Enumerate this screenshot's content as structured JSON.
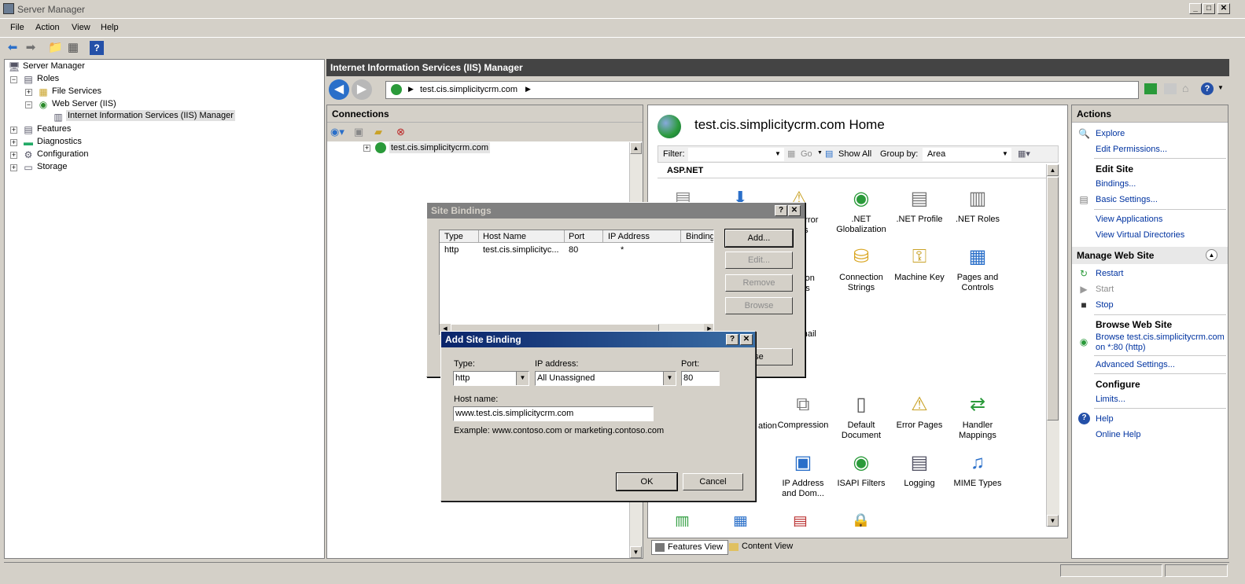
{
  "window": {
    "title": "Server Manager",
    "minimize": "_",
    "maximize": "□",
    "close": "✕"
  },
  "menu": [
    "File",
    "Action",
    "View",
    "Help"
  ],
  "tree": {
    "root": "Server Manager",
    "roles": "Roles",
    "file_services": "File Services",
    "web_server": "Web Server (IIS)",
    "iis_manager": "Internet Information Services (IIS) Manager",
    "features": "Features",
    "diagnostics": "Diagnostics",
    "configuration": "Configuration",
    "storage": "Storage"
  },
  "iis": {
    "header": "Internet Information Services (IIS) Manager",
    "address": "test.cis.simplicitycrm.com"
  },
  "connections": {
    "title": "Connections",
    "site": "test.cis.simplicitycrm.com"
  },
  "home": {
    "title": "test.cis.simplicitycrm.com Home",
    "filter_label": "Filter:",
    "go_label": "Go",
    "show_all": "Show All",
    "group_by_label": "Group by:",
    "group_by_value": "Area",
    "section": "ASP.NET",
    "features": [
      {
        "label": ".NET\nGlobalization"
      },
      {
        "label": ".NET Profile"
      },
      {
        "label": ".NET Roles"
      },
      {
        "label": "Connection\nStrings"
      },
      {
        "label": "Machine Key"
      },
      {
        "label": "Pages and\nControls"
      },
      {
        "label": "Compression"
      },
      {
        "label": "Default\nDocument"
      },
      {
        "label": "Error Pages"
      },
      {
        "label": "Handler\nMappings"
      },
      {
        "label": "IP Address\nand Dom..."
      },
      {
        "label": "ISAPI Filters"
      },
      {
        "label": "Logging"
      },
      {
        "label": "MIME Types"
      }
    ],
    "partial_error": "Error\nes",
    "partial_ation": "ation\nngs",
    "partial_mail": "-mail",
    "partial_ation2": "ation",
    "features_view": "Features View",
    "content_view": "Content View"
  },
  "actions": {
    "title": "Actions",
    "explore": "Explore",
    "edit_permissions": "Edit Permissions...",
    "edit_site": "Edit Site",
    "bindings": "Bindings...",
    "basic_settings": "Basic Settings...",
    "view_applications": "View Applications",
    "view_virtual_directories": "View Virtual Directories",
    "manage_web_site": "Manage Web Site",
    "restart": "Restart",
    "start": "Start",
    "stop": "Stop",
    "browse_web_site": "Browse Web Site",
    "browse_link_1": "Browse test.cis.simplicitycrm.com",
    "browse_link_2": "on *:80 (http)",
    "advanced_settings": "Advanced Settings...",
    "configure": "Configure",
    "limits": "Limits...",
    "help": "Help",
    "online_help": "Online Help"
  },
  "site_bindings": {
    "title": "Site Bindings",
    "columns": [
      "Type",
      "Host Name",
      "Port",
      "IP Address",
      "Binding"
    ],
    "row": [
      "http",
      "test.cis.simplicityc...",
      "80",
      "*"
    ],
    "add": "Add...",
    "edit": "Edit...",
    "remove": "Remove",
    "browse": "Browse",
    "close_partial": "ose"
  },
  "add_binding": {
    "title": "Add Site Binding",
    "type_label": "Type:",
    "type_value": "http",
    "ip_label": "IP address:",
    "ip_value": "All Unassigned",
    "port_label": "Port:",
    "port_value": "80",
    "host_label": "Host name:",
    "host_value": "www.test.cis.simplicitycrm.com",
    "example": "Example: www.contoso.com or marketing.contoso.com",
    "ok": "OK",
    "cancel": "Cancel"
  },
  "colors": {
    "dialog_title_active": "#0a246a",
    "dialog_title_inactive": "#808080",
    "link": "#0033a0"
  }
}
